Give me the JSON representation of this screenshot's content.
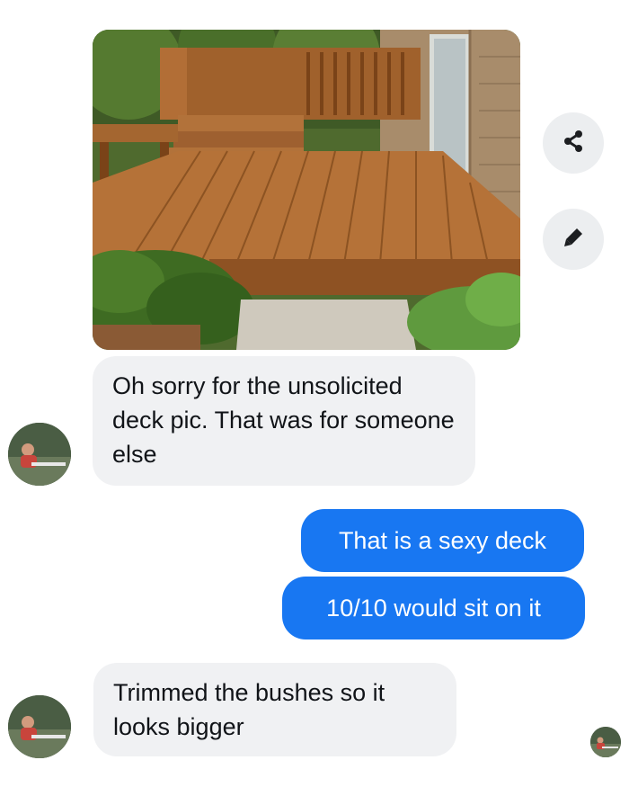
{
  "conversation": {
    "photo": {
      "alt": "wooden deck photo",
      "icon": "deck-photo"
    },
    "actions": {
      "share_icon": "share-icon",
      "edit_icon": "pencil-icon"
    },
    "messages": [
      {
        "direction": "incoming",
        "text": "Oh sorry for the unsolicited deck pic. That was for someone else"
      },
      {
        "direction": "outgoing",
        "text": "That is a sexy deck"
      },
      {
        "direction": "outgoing",
        "text": "10/10 would sit on it"
      },
      {
        "direction": "incoming",
        "text": "Trimmed the bushes so it looks bigger"
      }
    ]
  },
  "colors": {
    "outgoing_bubble": "#1877f2",
    "incoming_bubble": "#f0f1f3",
    "background": "#ffffff"
  }
}
